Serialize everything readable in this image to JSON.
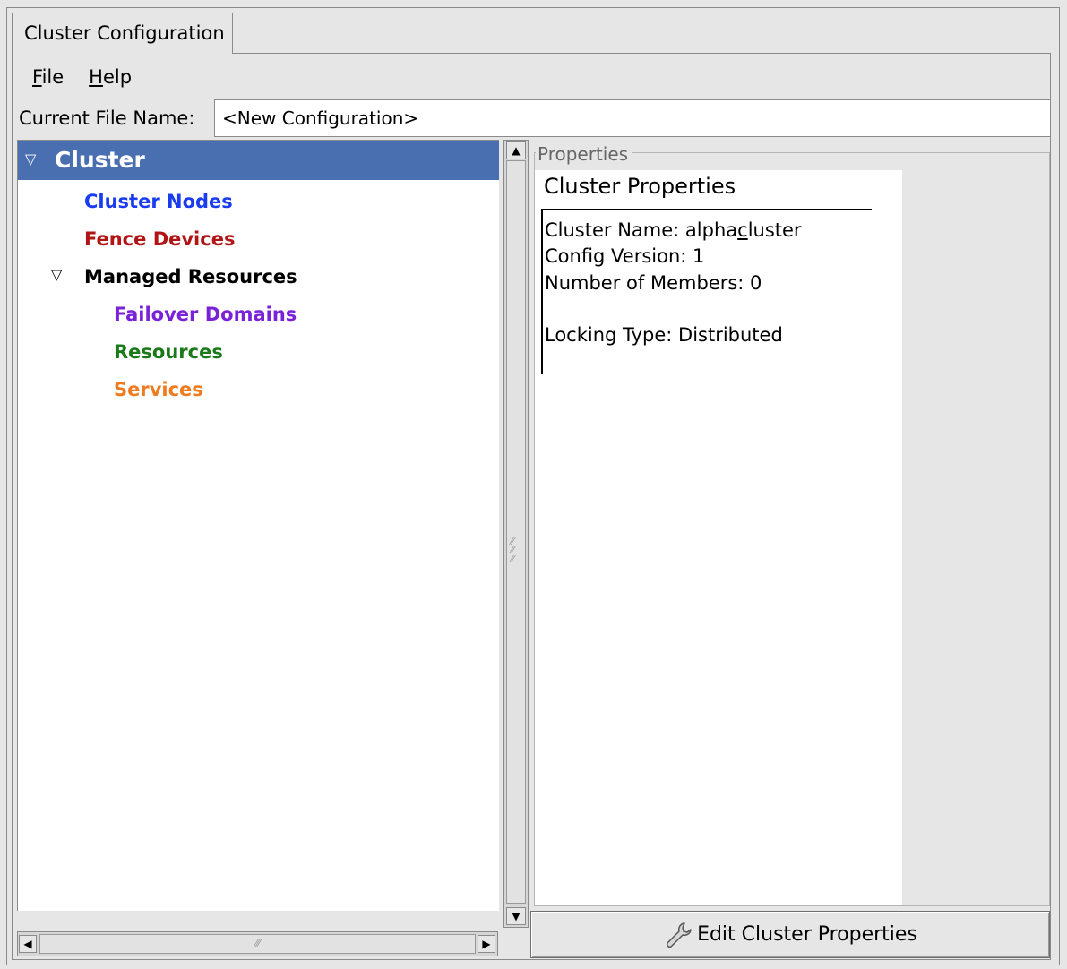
{
  "tab": {
    "title": "Cluster Configuration"
  },
  "menu": [
    {
      "label": "File",
      "mnemonic": "F",
      "rest": "ile"
    },
    {
      "label": "Help",
      "mnemonic": "H",
      "rest": "elp"
    }
  ],
  "file_name": {
    "label": "Current File Name:",
    "value": "<New Configuration>"
  },
  "tree": {
    "root": {
      "label": "Cluster",
      "expanded": true,
      "selected": true
    },
    "items": [
      {
        "label": "Cluster Nodes",
        "color": "#1a3cf0",
        "indent": 1
      },
      {
        "label": "Fence Devices",
        "color": "#b01414",
        "indent": 1
      },
      {
        "label": "Managed Resources",
        "color": "#000000",
        "indent": 1,
        "expanded": true
      },
      {
        "label": "Failover Domains",
        "color": "#7a22d8",
        "indent": 2
      },
      {
        "label": "Resources",
        "color": "#1a7a1a",
        "indent": 2
      },
      {
        "label": "Services",
        "color": "#f07a1e",
        "indent": 2
      }
    ]
  },
  "properties": {
    "legend": "Properties",
    "title": "Cluster Properties",
    "cluster_name_prefix": "Cluster Name: alpha",
    "cluster_name_underlined": "c",
    "cluster_name_suffix": "luster",
    "config_version": "Config Version: 1",
    "members": "Number of Members: 0",
    "locking": "Locking Type: Distributed"
  },
  "edit_button": {
    "label": "Edit Cluster Properties",
    "icon": "wrench-icon"
  }
}
